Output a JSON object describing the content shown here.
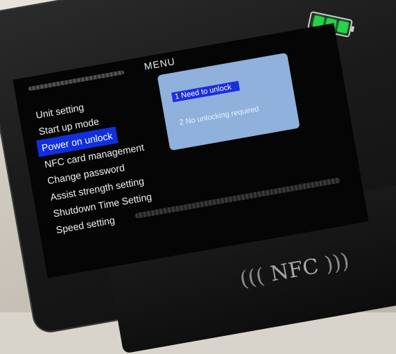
{
  "screen": {
    "title": "MENU",
    "menu_items": [
      {
        "label": "Unit setting",
        "active": false
      },
      {
        "label": "Start up mode",
        "active": false
      },
      {
        "label": "Power on unlock",
        "active": true
      },
      {
        "label": "NFC card management",
        "active": false
      },
      {
        "label": "Change password",
        "active": false
      },
      {
        "label": "Assist strength setting",
        "active": false
      },
      {
        "label": "Shutdown Time Setting",
        "active": false
      },
      {
        "label": "Speed setting",
        "active": false
      }
    ],
    "submenu": [
      {
        "label": "1  Need to unlock",
        "active": true
      },
      {
        "label": "2  No unlocking required",
        "active": false
      }
    ]
  },
  "battery": {
    "bars_lit": 3,
    "bars_total": 3,
    "color": "#27d34a"
  },
  "nfc_label": "NFC",
  "colors": {
    "highlight": "#1030e0",
    "submenu_bg": "#8fb1dc"
  }
}
